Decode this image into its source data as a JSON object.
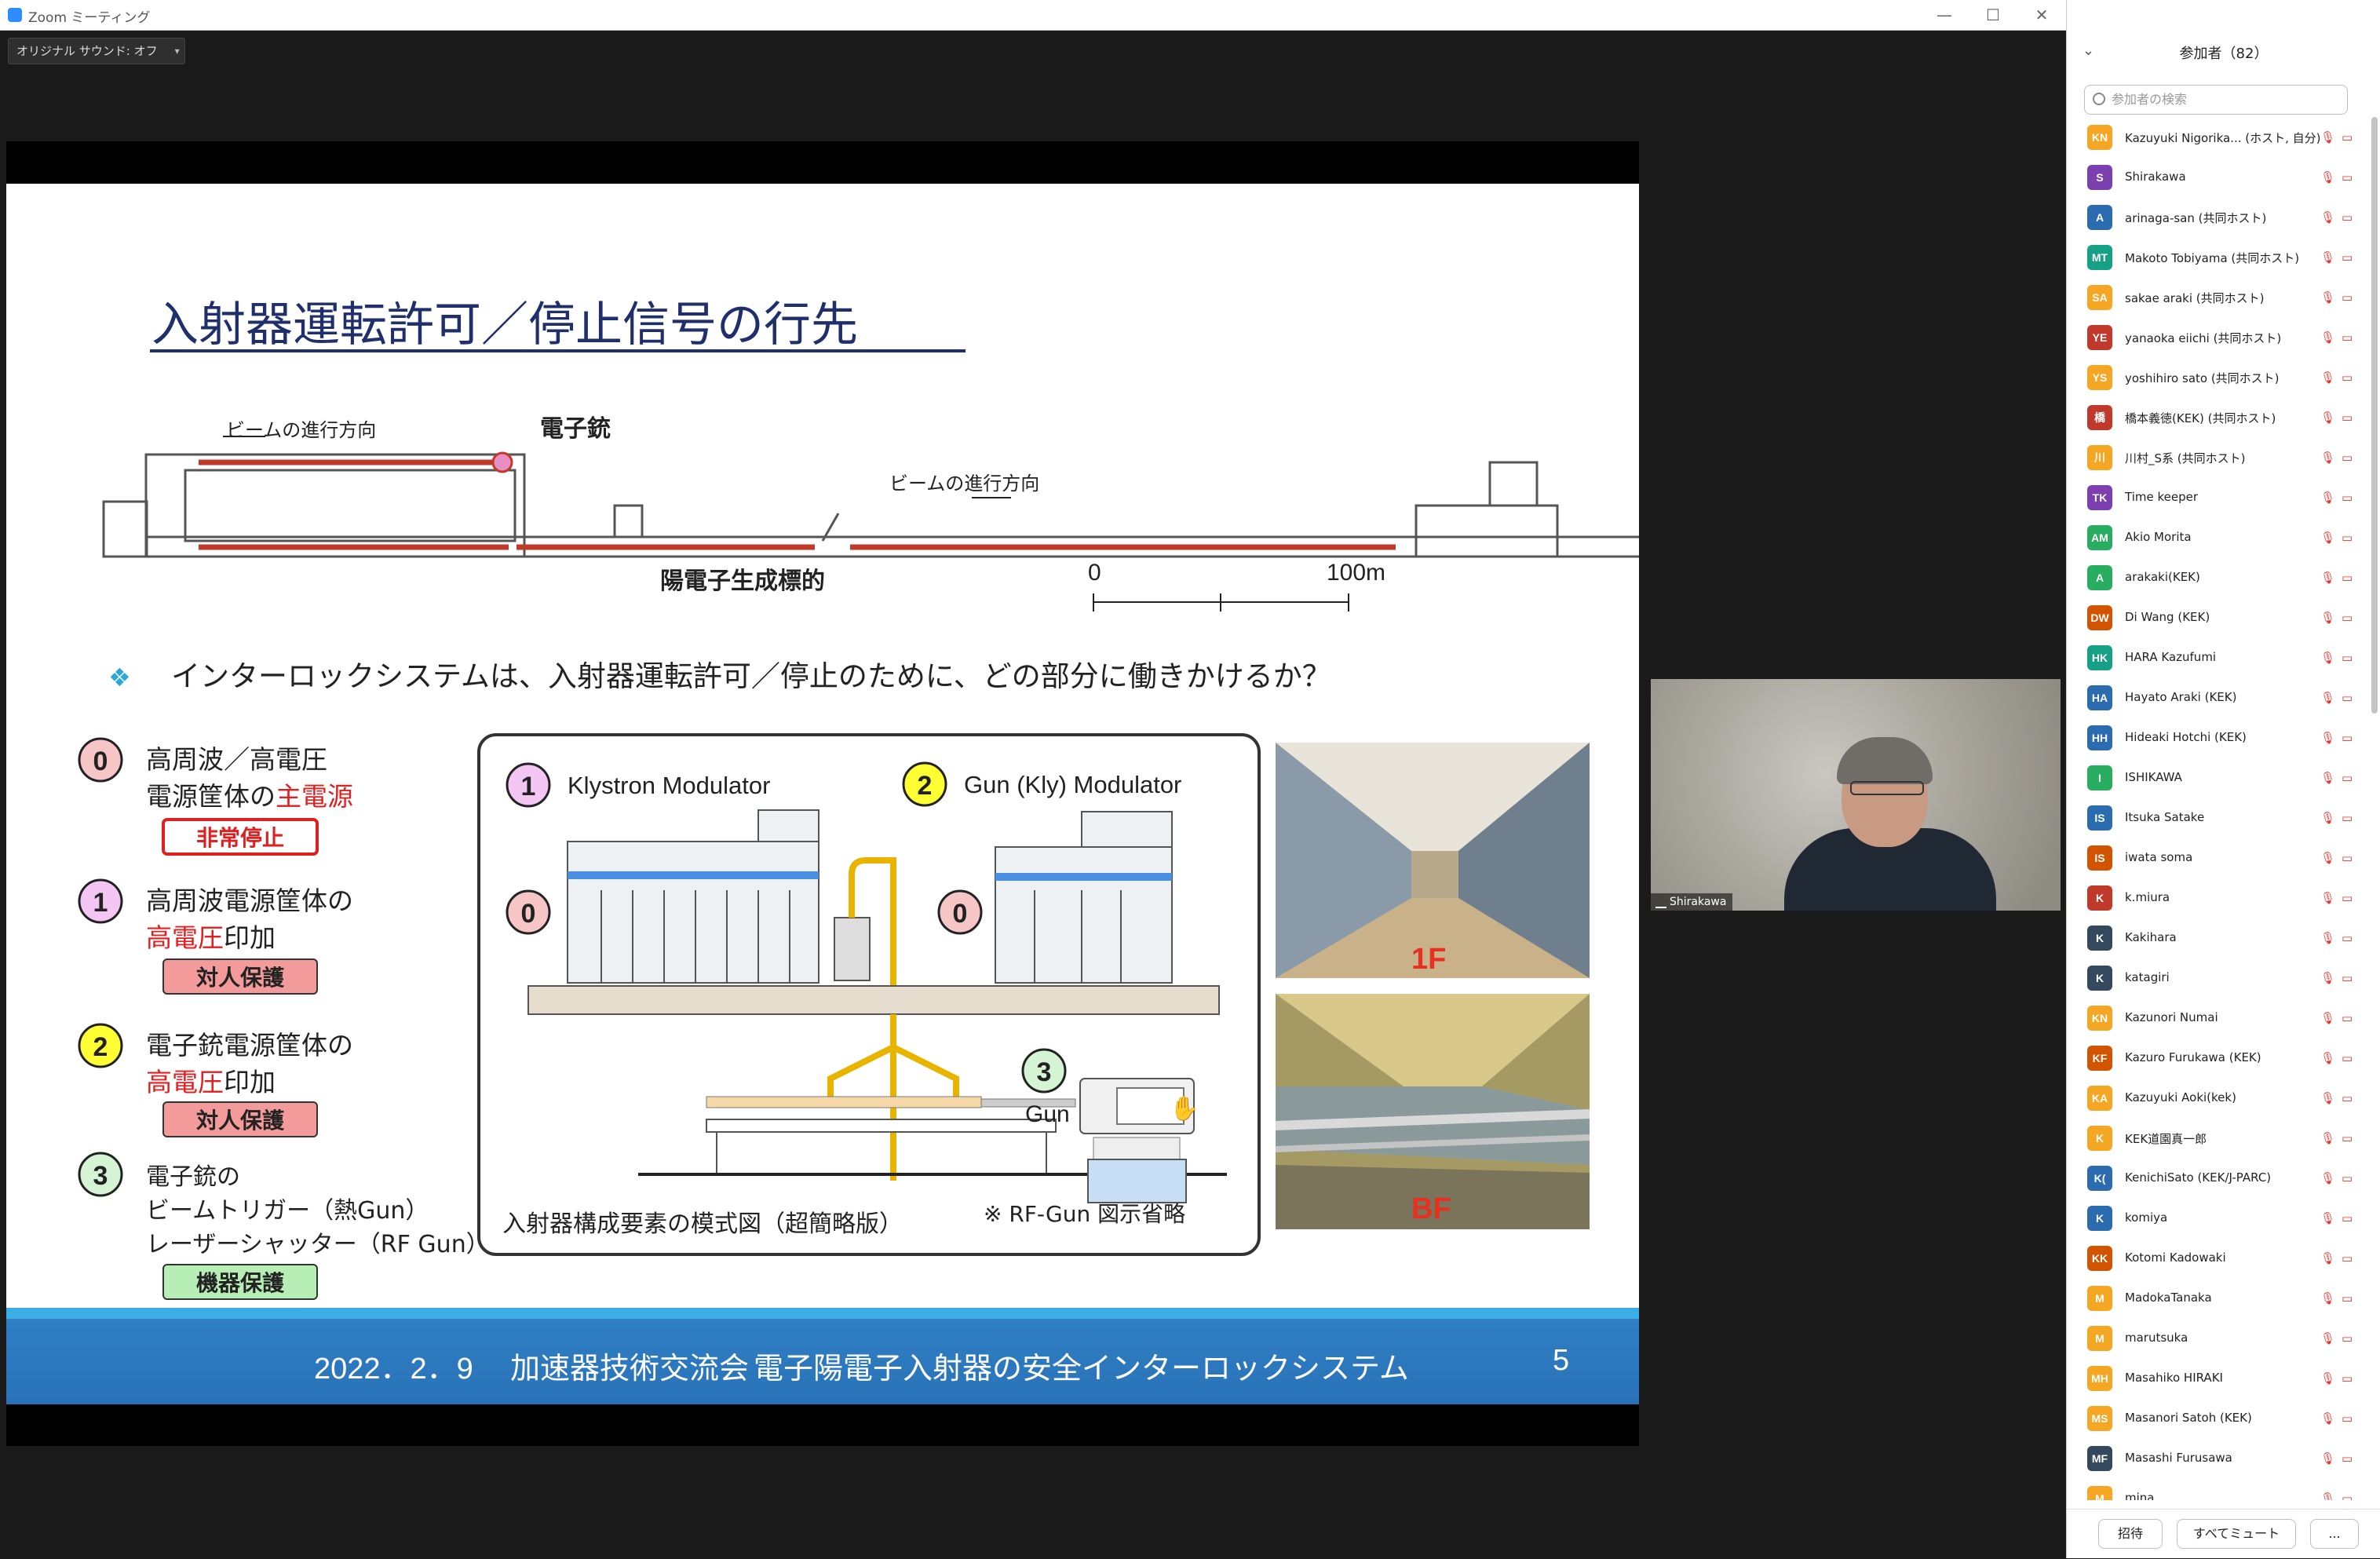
{
  "window": {
    "title": "Zoom ミーティング",
    "controls": [
      "—",
      "☐",
      "✕"
    ]
  },
  "toolbar": {
    "sound_label": "オリジナル サウンド: オフ",
    "caret": "▾"
  },
  "slide": {
    "title": "入射器運転許可／停止信号の行先",
    "diagram": {
      "beam_dir_left": "ビームの進行方向",
      "beam_dir_right": "ビームの進行方向",
      "electron_gun": "電子銃",
      "positron_target": "陽電子生成標的",
      "scale_0": "0",
      "scale_100": "100m"
    },
    "question": "インターロックシステムは、入射器運転許可／停止のために、どの部分に働きかけるか？",
    "items": [
      {
        "num": "0",
        "line1": "高周波／高電圧",
        "line2a": "電源筐体の",
        "line2b": "主電源",
        "line3": "",
        "badge": "非常停止"
      },
      {
        "num": "1",
        "line1": "高周波電源筐体の",
        "line2a": "",
        "line2b": "高電圧",
        "line2c": "印加",
        "badge": "対人保護"
      },
      {
        "num": "2",
        "line1": "電子銃電源筐体の",
        "line2a": "",
        "line2b": "高電圧",
        "line2c": "印加",
        "badge": "対人保護"
      },
      {
        "num": "3",
        "line1": "電子銃の",
        "line2": "ビームトリガー（熱Gun）",
        "line3": "レーザーシャッター（RF Gun）",
        "badge": "機器保護"
      }
    ],
    "schematic": {
      "klystron": "Klystron Modulator",
      "gun_mod": "Gun (Kly) Modulator",
      "gun": "Gun",
      "caption": "入射器構成要素の模式図（超簡略版）",
      "note": "※ RF-Gun 図示省略",
      "n1": "1",
      "n2": "2",
      "n0": "0",
      "n3": "3"
    },
    "photos": {
      "top_label": "1F",
      "bottom_label": "BF"
    },
    "footer": {
      "date": "2022．2．9",
      "event": "加速器技術交流会",
      "topic": "電子陽電子入射器の安全インターロックシステム",
      "page": "5"
    }
  },
  "video": {
    "name": "Shirakawa"
  },
  "panel": {
    "collapse_icon": "⌄",
    "title": "参加者（82）",
    "search_placeholder": "参加者の検索",
    "participants": [
      {
        "initials": "KN",
        "color": "#f5a623",
        "name": "Kazuyuki Nigorika... (ホスト, 自分)"
      },
      {
        "initials": "S",
        "color": "#7b3fb0",
        "name": "Shirakawa"
      },
      {
        "initials": "A",
        "color": "#2b6cb0",
        "name": "arinaga-san (共同ホスト)"
      },
      {
        "initials": "MT",
        "color": "#16a085",
        "name": "Makoto Tobiyama (共同ホスト)"
      },
      {
        "initials": "SA",
        "color": "#f5a623",
        "name": "sakae araki (共同ホスト)"
      },
      {
        "initials": "YE",
        "color": "#c0392b",
        "name": "yanaoka eiichi (共同ホスト)"
      },
      {
        "initials": "YS",
        "color": "#f5a623",
        "name": "yoshihiro sato (共同ホスト)"
      },
      {
        "initials": "橋",
        "color": "#c0392b",
        "name": "橋本義徳(KEK) (共同ホスト)"
      },
      {
        "initials": "川",
        "color": "#f5a623",
        "name": "川村_S系 (共同ホスト)"
      },
      {
        "initials": "TK",
        "color": "#7b3fb0",
        "name": "Time keeper"
      },
      {
        "initials": "AM",
        "color": "#27ae60",
        "name": "Akio Morita"
      },
      {
        "initials": "A",
        "color": "#27ae60",
        "name": "arakaki(KEK)"
      },
      {
        "initials": "DW",
        "color": "#d35400",
        "name": "Di Wang (KEK)"
      },
      {
        "initials": "HK",
        "color": "#16a085",
        "name": "HARA Kazufumi"
      },
      {
        "initials": "HA",
        "color": "#2b6cb0",
        "name": "Hayato Araki (KEK)"
      },
      {
        "initials": "HH",
        "color": "#2b6cb0",
        "name": "Hideaki Hotchi (KEK)"
      },
      {
        "initials": "I",
        "color": "#27ae60",
        "name": "ISHIKAWA"
      },
      {
        "initials": "IS",
        "color": "#2b6cb0",
        "name": "Itsuka Satake"
      },
      {
        "initials": "IS",
        "color": "#d35400",
        "name": "iwata soma"
      },
      {
        "initials": "K",
        "color": "#c0392b",
        "name": "k.miura"
      },
      {
        "initials": "K",
        "color": "#34495e",
        "name": "Kakihara"
      },
      {
        "initials": "K",
        "color": "#34495e",
        "name": "katagiri"
      },
      {
        "initials": "KN",
        "color": "#f5a623",
        "name": "Kazunori Numai"
      },
      {
        "initials": "KF",
        "color": "#d35400",
        "name": "Kazuro Furukawa (KEK)"
      },
      {
        "initials": "KA",
        "color": "#f5a623",
        "name": "Kazuyuki Aoki(kek)"
      },
      {
        "initials": "K",
        "color": "#f5a623",
        "name": "KEK道園真一郎"
      },
      {
        "initials": "K(",
        "color": "#2b6cb0",
        "name": "KenichiSato (KEK/J-PARC)"
      },
      {
        "initials": "K",
        "color": "#2b6cb0",
        "name": "komiya"
      },
      {
        "initials": "KK",
        "color": "#d35400",
        "name": "Kotomi Kadowaki"
      },
      {
        "initials": "M",
        "color": "#f5a623",
        "name": "MadokaTanaka"
      },
      {
        "initials": "M",
        "color": "#f5a623",
        "name": "marutsuka"
      },
      {
        "initials": "MH",
        "color": "#f5a623",
        "name": "Masahiko HIRAKI"
      },
      {
        "initials": "MS",
        "color": "#f5a623",
        "name": "Masanori Satoh (KEK)"
      },
      {
        "initials": "MF",
        "color": "#34495e",
        "name": "Masashi Furusawa"
      },
      {
        "initials": "M",
        "color": "#f5a623",
        "name": "mina"
      }
    ],
    "invite": "招待",
    "mute_all": "すべてミュート",
    "more": "..."
  }
}
